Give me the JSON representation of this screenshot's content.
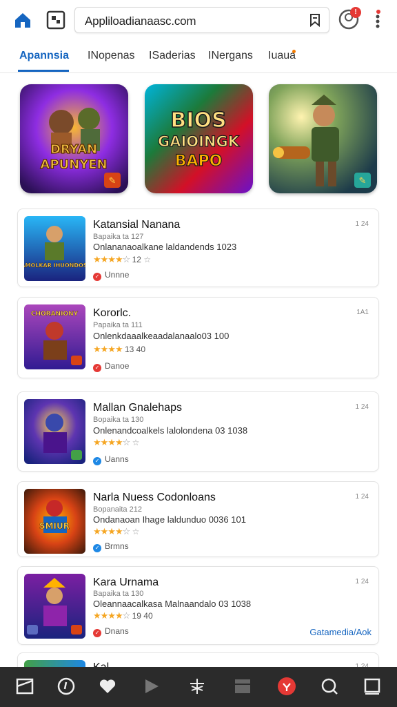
{
  "browser": {
    "url": "Appliloadianaasc.com",
    "account_badge": "!",
    "icons": [
      "home-icon",
      "qr-icon",
      "bookmark-icon",
      "account-icon",
      "more-icon"
    ]
  },
  "tabs": [
    {
      "label": "Apannsia",
      "active": true
    },
    {
      "label": "INopenas",
      "active": false
    },
    {
      "label": "ISaderias",
      "active": false
    },
    {
      "label": "INergans",
      "active": false
    },
    {
      "label": "Iuaua",
      "active": false
    }
  ],
  "featured": [
    {
      "title_line1": "DRYAN",
      "title_line2": "APUNYEN"
    },
    {
      "title_line1": "BIOS",
      "title_line2": "GAIOINGK",
      "title_line3": "BAPO"
    },
    {
      "title_line1": "",
      "title_line2": ""
    }
  ],
  "apps": [
    {
      "title": "Katansial Nanana",
      "sub": "Bapaika ta 127",
      "desc": "Onlananaoalkane laldandends 1023",
      "rating": "4.5",
      "rating_text": "12",
      "status": "Unnne",
      "status_color": "#e53935",
      "time": "1 24",
      "thumb_text": "YAMOLKAR IHUONDOSK"
    },
    {
      "title": "Kororlc.",
      "sub": "Papaika ta 111",
      "desc": "Onlenkdaaalkeaadalanaalo03 100",
      "rating": "4",
      "rating_text": "13 40",
      "status": "Danoe",
      "status_color": "#e53935",
      "time": "1A1",
      "thumb_text": "CHORANIONY"
    },
    {
      "title": "Mallan Gnalehaps",
      "sub": "Bopaika ta 130",
      "desc": "Onlenandcoalkels lalolondena 03 1038",
      "rating": "4.5",
      "rating_text": "",
      "status": "Uanns",
      "status_color": "#1e88e5",
      "time": "1 24",
      "thumb_text": ""
    },
    {
      "title": "Narla Nuess Codonloans",
      "sub": "Bopanaita 212",
      "desc": "Ondanaoan Ihage laldunduo 0036 101",
      "rating": "4",
      "rating_text": "",
      "status": "Brmns",
      "status_color": "#1e88e5",
      "time": "1 24",
      "thumb_text": "SMIUR"
    },
    {
      "title": "Kara Urnama",
      "sub": "Bapaika ta 130",
      "desc": "Oleannaacalkasa Malnaandalo 03 1038",
      "rating": "4",
      "rating_text": "19 40",
      "status": "Dnans",
      "status_color": "#e53935",
      "time": "1 24",
      "thumb_text": "",
      "link": "Gatamedia/Aok"
    }
  ],
  "partial_card": {
    "title": "Kal",
    "time": "1 24"
  },
  "bottom_nav": [
    "grid-icon",
    "info-icon",
    "heart-icon",
    "play-icon",
    "hub-icon",
    "gallery-icon",
    "record-icon",
    "search-icon",
    "tab-icon"
  ],
  "colors": {
    "accent": "#1565c0",
    "star": "#f5a623",
    "danger": "#e53935",
    "navbar": "#2b2b2b"
  }
}
